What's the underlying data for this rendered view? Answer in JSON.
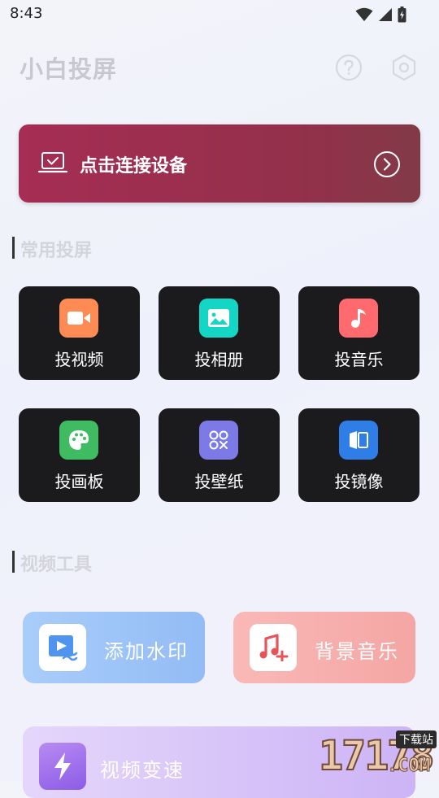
{
  "status": {
    "time": "8:43"
  },
  "header": {
    "title": "小白投屏"
  },
  "connect": {
    "label": "点击连接设备"
  },
  "sections": {
    "common": "常用投屏",
    "tools": "视频工具"
  },
  "tiles": [
    {
      "label": "投视频",
      "icon": "video-camera-icon",
      "color": "#ff8b54"
    },
    {
      "label": "投相册",
      "icon": "image-icon",
      "color": "#14d6c4"
    },
    {
      "label": "投音乐",
      "icon": "music-note-icon",
      "color": "#ff6a6f"
    },
    {
      "label": "投画板",
      "icon": "palette-icon",
      "color": "#3fbb62"
    },
    {
      "label": "投壁纸",
      "icon": "grid-icon",
      "color": "#7b7ae6"
    },
    {
      "label": "投镜像",
      "icon": "mirror-icon",
      "color": "#2f7ee8"
    }
  ],
  "tools": [
    {
      "label": "添加水印"
    },
    {
      "label": "背景音乐"
    },
    {
      "label": "视频变速"
    }
  ],
  "watermark": {
    "text": "17178",
    "suffix": ".COM",
    "badge": "下载站"
  }
}
